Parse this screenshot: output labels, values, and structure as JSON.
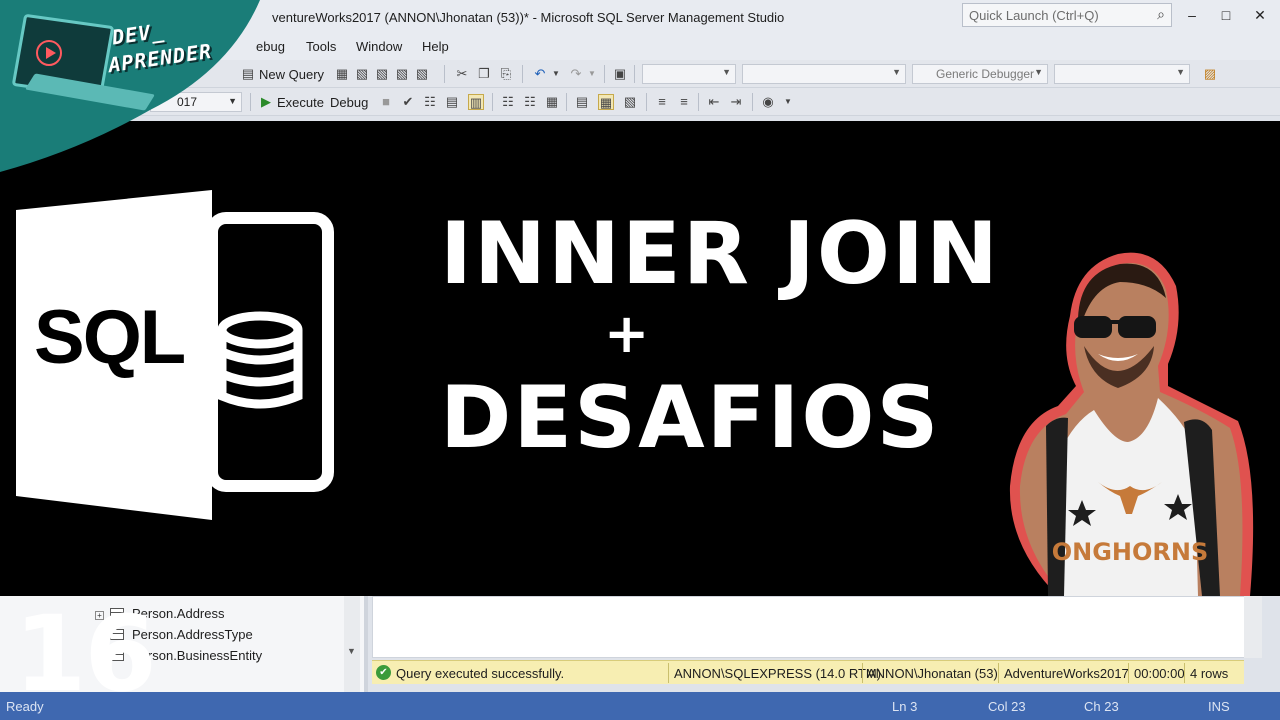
{
  "window": {
    "title": "ventureWorks2017 (ANNON\\Jhonatan (53))* - Microsoft SQL Server Management Studio",
    "quick_launch_placeholder": "Quick Launch (Ctrl+Q)"
  },
  "menu": [
    "ebug",
    "Tools",
    "Window",
    "Help"
  ],
  "toolbar1": {
    "new_query": "New Query",
    "debugger": "Generic Debugger"
  },
  "toolbar2": {
    "database": "017",
    "execute": "Execute",
    "debug": "Debug"
  },
  "object_explorer": {
    "items": [
      "Person.Address",
      "Person.AddressType",
      "Person.BusinessEntity"
    ]
  },
  "query_status": {
    "message": "Query executed successfully.",
    "server": "ANNON\\SQLEXPRESS (14.0 RTM)",
    "user": "ANNON\\Jhonatan (53)",
    "database": "AdventureWorks2017",
    "elapsed": "00:00:00",
    "rows": "4 rows"
  },
  "statusbar": {
    "ready": "Ready",
    "ln": "Ln 3",
    "col": "Col 23",
    "ch": "Ch 23",
    "mode": "INS"
  },
  "thumbnail": {
    "brand_line1": "DEV_",
    "brand_line2": "APRENDER",
    "logo_text": "SQL",
    "headline_line1": "INNER JOIN",
    "headline_plus": "+",
    "headline_line2": "DESAFIOS",
    "episode_number": "16",
    "shirt_text": "ONGHORNS"
  },
  "colors": {
    "teal_corner": "#1a7d78",
    "status_blue": "#3f68b0",
    "query_ok_yellow": "#f7eeb2",
    "person_outline": "#e0524f"
  }
}
